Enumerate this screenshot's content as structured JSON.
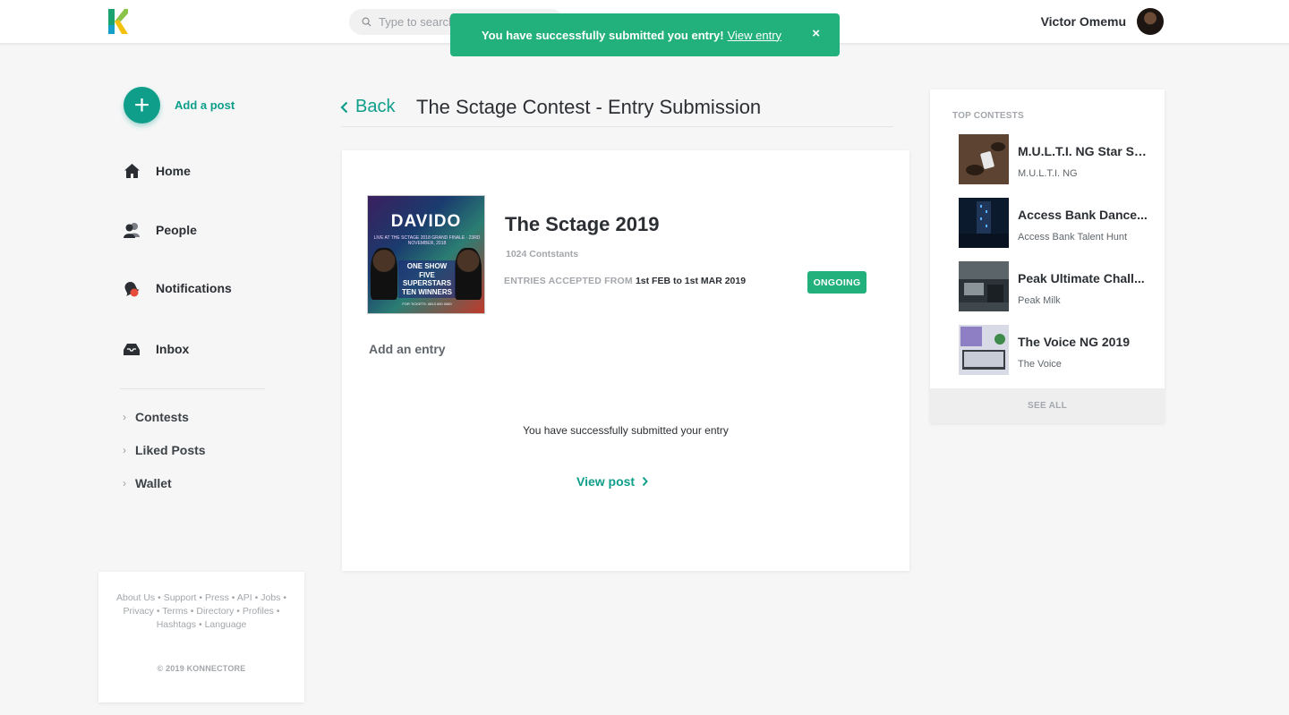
{
  "header": {
    "search_placeholder": "Type to search",
    "user_name": "Victor Omemu"
  },
  "toast": {
    "message": "You have successfully submitted you entry!",
    "link_label": "View entry",
    "close_label": "×"
  },
  "sidebar": {
    "add_post_label": "Add a post",
    "nav": [
      {
        "label": "Home",
        "icon": "home-icon"
      },
      {
        "label": "People",
        "icon": "people-icon"
      },
      {
        "label": "Notifications",
        "icon": "bell-icon"
      },
      {
        "label": "Inbox",
        "icon": "inbox-icon"
      }
    ],
    "sub_nav": [
      {
        "label": "Contests"
      },
      {
        "label": "Liked Posts"
      },
      {
        "label": "Wallet"
      }
    ],
    "footer": {
      "links": [
        "About Us",
        "Support",
        "Press",
        "API",
        "Jobs",
        "Privacy",
        "Terms",
        "Directory",
        "Profiles",
        "Hashtags",
        "Language"
      ],
      "copyright": "© 2019 KONNECTORE"
    }
  },
  "main": {
    "back_label": "Back",
    "page_title": "The Sctage Contest - Entry Submission",
    "contest": {
      "name": "The Sctage 2019",
      "contestants": "1024 Contstants",
      "entries_prefix": "ENTRIES ACCEPTED FROM",
      "entries_range": "1st FEB to 1st MAR 2019",
      "status": "ONGOING",
      "poster_text": {
        "headline": "DAVIDO",
        "sub": "LIVE AT THE SCTAGE 2018 GRAND FINALE · 23RD NOVEMBER, 2018",
        "promo": "ONE SHOW FIVE SUPERSTARS TEN WINNERS",
        "footer": "FOR TICKETS: 0813 000 0000"
      }
    },
    "add_entry_label": "Add an entry",
    "success_message": "You have successfully submitted your entry",
    "view_post_label": "View post"
  },
  "right_panel": {
    "heading": "TOP CONTESTS",
    "contests": [
      {
        "title": "M.U.L.T.I. NG Star Se...",
        "subtitle": "M.U.L.T.I. NG"
      },
      {
        "title": "Access Bank Dance...",
        "subtitle": "Access Bank Talent Hunt"
      },
      {
        "title": "Peak Ultimate Chall...",
        "subtitle": "Peak Milk"
      },
      {
        "title": "The Voice NG 2019",
        "subtitle": "The Voice"
      }
    ],
    "see_all_label": "SEE ALL"
  },
  "colors": {
    "accent": "#0e9e8a",
    "success": "#22b07d",
    "text": "#2b2f33",
    "muted": "#a3a7ab"
  }
}
